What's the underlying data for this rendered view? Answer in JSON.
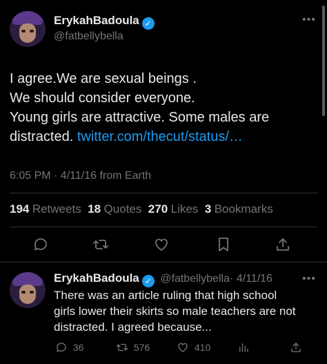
{
  "main_tweet": {
    "display_name": "ErykahBadoula",
    "handle": "@fatbellybella",
    "text_lines": [
      "I agree.We are sexual beings .",
      "We should consider everyone.",
      "Young girls are attractive. Some males are",
      "distracted."
    ],
    "link": "twitter.com/thecut/status/…",
    "timestamp": "6:05 PM · 4/11/16 from Earth",
    "stats": {
      "retweets_count": "194",
      "retweets_label": "Retweets",
      "quotes_count": "18",
      "quotes_label": "Quotes",
      "likes_count": "270",
      "likes_label": "Likes",
      "bookmarks_count": "3",
      "bookmarks_label": "Bookmarks"
    },
    "more_icon": "more-dots-icon"
  },
  "actions": [
    "reply-icon",
    "retweet-icon",
    "like-icon",
    "bookmark-icon",
    "share-icon"
  ],
  "reply_tweet": {
    "display_name": "ErykahBadoula",
    "handle": "@fatbellybella",
    "date": "· 4/11/16",
    "text_lines": [
      "There was an article ruling that high school",
      "girls lower their skirts so male teachers are not",
      "distracted. I agreed because..."
    ],
    "replies": "36",
    "retweets": "576",
    "likes": "410"
  },
  "colors": {
    "background": "#000000",
    "accent": "#1d9bf0",
    "muted": "#71767b",
    "text": "#e7e9ea"
  }
}
